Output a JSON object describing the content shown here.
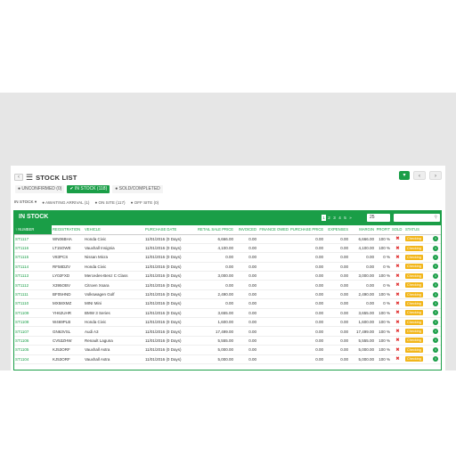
{
  "header": {
    "back_label": "‹",
    "title": "STOCK LIST"
  },
  "toolbar": {
    "green_btn": "▾",
    "prev": "‹",
    "next": "›"
  },
  "status_tabs": [
    {
      "label": "UNCONFIRMED (0)",
      "active": false
    },
    {
      "label": "IN STOCK (118)",
      "active": true
    },
    {
      "label": "SOLD/COMPLETED",
      "active": false
    }
  ],
  "location": {
    "label": "IN STOCK ▾",
    "items": [
      "AWAITING ARRIVAL (1)",
      "ON SITE (117)",
      "OFF SITE (0)"
    ]
  },
  "grid": {
    "title": "IN STOCK",
    "pages": [
      "1",
      "2",
      "3",
      "4",
      "5",
      "»"
    ],
    "per_page": "25",
    "columns": [
      "NUMBER",
      "REGISTRATION",
      "VEHICLE",
      "PURCHASE DATE",
      "RETAIL SALE PRICE",
      "INVOICED",
      "FINANCE OWED",
      "PURCHASE PRICE",
      "EXPENSES",
      "MARGIN",
      "PROFIT",
      "SOLD",
      "STATUS",
      ""
    ],
    "rows": [
      [
        "ST1117",
        "WN06BHA",
        "Honda Civic",
        "11/01/2016 (0 Days)",
        "6,666.00",
        "0.00",
        "",
        "0.00",
        "0.00",
        "6,666.00",
        "100 %",
        "✖",
        "Checking"
      ],
      [
        "ST1116",
        "LT15OWE",
        "Vauxhall Insignia",
        "11/01/2016 (0 Days)",
        "4,100.00",
        "0.00",
        "",
        "0.00",
        "0.00",
        "4,100.00",
        "100 %",
        "✖",
        "Checking"
      ],
      [
        "ST1115",
        "V83PCS",
        "Nissan Micra",
        "11/01/2016 (0 Days)",
        "0.00",
        "0.00",
        "",
        "0.00",
        "0.00",
        "0.00",
        "0 %",
        "✖",
        "Checking"
      ],
      [
        "ST1114",
        "RF58DZV",
        "Honda Civic",
        "11/01/2016 (0 Days)",
        "0.00",
        "0.00",
        "",
        "0.00",
        "0.00",
        "0.00",
        "0 %",
        "✖",
        "Checking"
      ],
      [
        "ST1113",
        "LY02FXD",
        "Mercedes-Benz C Class",
        "11/01/2016 (0 Days)",
        "3,000.00",
        "0.00",
        "",
        "0.00",
        "0.00",
        "3,000.00",
        "100 %",
        "✖",
        "Checking"
      ],
      [
        "ST1112",
        "X395OBV",
        "Citroen Xsara",
        "11/01/2016 (0 Days)",
        "0.00",
        "0.00",
        "",
        "0.00",
        "0.00",
        "0.00",
        "0 %",
        "✖",
        "Checking"
      ],
      [
        "ST1111",
        "BF05HND",
        "Volkswagen Golf",
        "11/01/2016 (0 Days)",
        "2,490.00",
        "0.00",
        "",
        "0.00",
        "0.00",
        "2,490.00",
        "100 %",
        "✖",
        "Checking"
      ],
      [
        "ST1110",
        "MX58XMZ",
        "MINI Mini",
        "11/01/2016 (0 Days)",
        "0.00",
        "0.00",
        "",
        "0.00",
        "0.00",
        "0.00",
        "0 %",
        "✖",
        "Checking"
      ],
      [
        "ST1109",
        "YH62UHR",
        "BMW 3 Series",
        "11/01/2016 (0 Days)",
        "3,655.00",
        "0.00",
        "",
        "0.00",
        "0.00",
        "3,655.00",
        "100 %",
        "✖",
        "Checking"
      ],
      [
        "ST1108",
        "W469PLB",
        "Honda Civic",
        "11/01/2016 (0 Days)",
        "1,600.00",
        "0.00",
        "",
        "0.00",
        "0.00",
        "1,600.00",
        "100 %",
        "✖",
        "Checking"
      ],
      [
        "ST1107",
        "GN63VSL",
        "Audi A3",
        "11/01/2016 (0 Days)",
        "17,499.00",
        "0.00",
        "",
        "0.00",
        "0.00",
        "17,499.00",
        "100 %",
        "✖",
        "Checking"
      ],
      [
        "ST1106",
        "CV53ZHW",
        "Renault Laguna",
        "11/01/2016 (0 Days)",
        "5,555.00",
        "0.00",
        "",
        "0.00",
        "0.00",
        "5,555.00",
        "100 %",
        "✖",
        "Checking"
      ],
      [
        "ST1105",
        "KJ53ORF",
        "Vauxhall Astra",
        "11/01/2016 (0 Days)",
        "5,000.00",
        "0.00",
        "",
        "0.00",
        "0.00",
        "5,000.00",
        "100 %",
        "✖",
        "Checking"
      ],
      [
        "ST1104",
        "KJ53ORF",
        "Vauxhall Astra",
        "11/01/2016 (0 Days)",
        "5,000.00",
        "0.00",
        "",
        "0.00",
        "0.00",
        "5,000.00",
        "100 %",
        "✖",
        "Checking"
      ]
    ],
    "info_label": "i"
  },
  "colors": {
    "accent": "#1a9e47",
    "status_badge": "#f2b61b",
    "sold_no": "#e03030"
  }
}
